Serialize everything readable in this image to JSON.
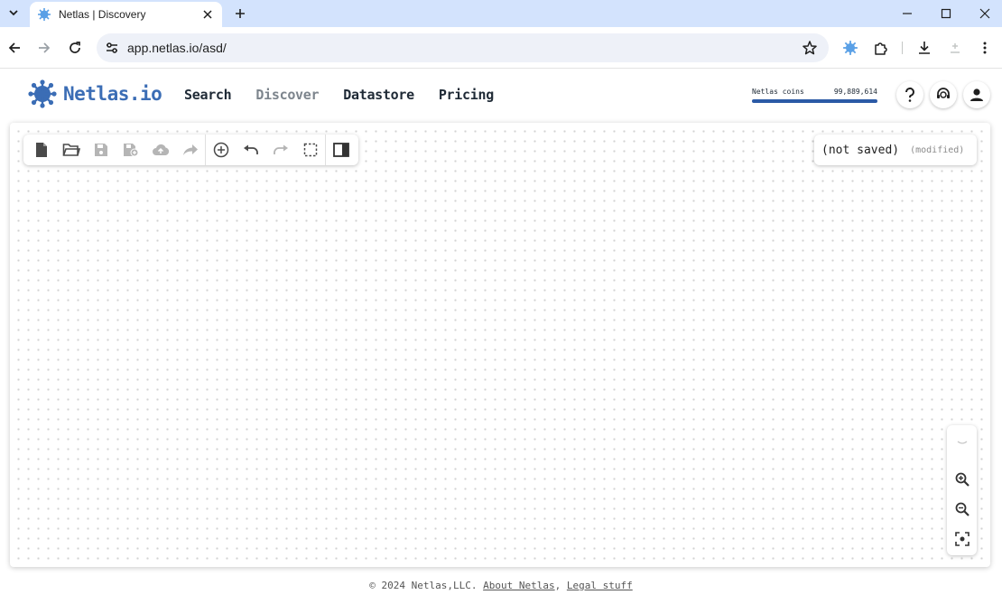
{
  "browser": {
    "tab_title": "Netlas | Discovery",
    "url": "app.netlas.io/asd/"
  },
  "header": {
    "logo_text": "Netlas.io",
    "nav": [
      "Search",
      "Discover",
      "Datastore",
      "Pricing"
    ],
    "active_nav": "Discover",
    "coins_label": "Netlas coins",
    "coins_value": "99,889,614",
    "coins_fill": 1.0
  },
  "canvas": {
    "status": "(not saved)",
    "modified": "(modified)"
  },
  "footer": {
    "copyright": "© 2024 Netlas,LLC.",
    "about": "About Netlas",
    "sep": ",",
    "legal": "Legal stuff"
  },
  "colors": {
    "brand": "#3b6db5",
    "tabstrip": "#d3e3fd",
    "coins_bar": "#2b5aa6",
    "nav_active": "#7d858d"
  }
}
